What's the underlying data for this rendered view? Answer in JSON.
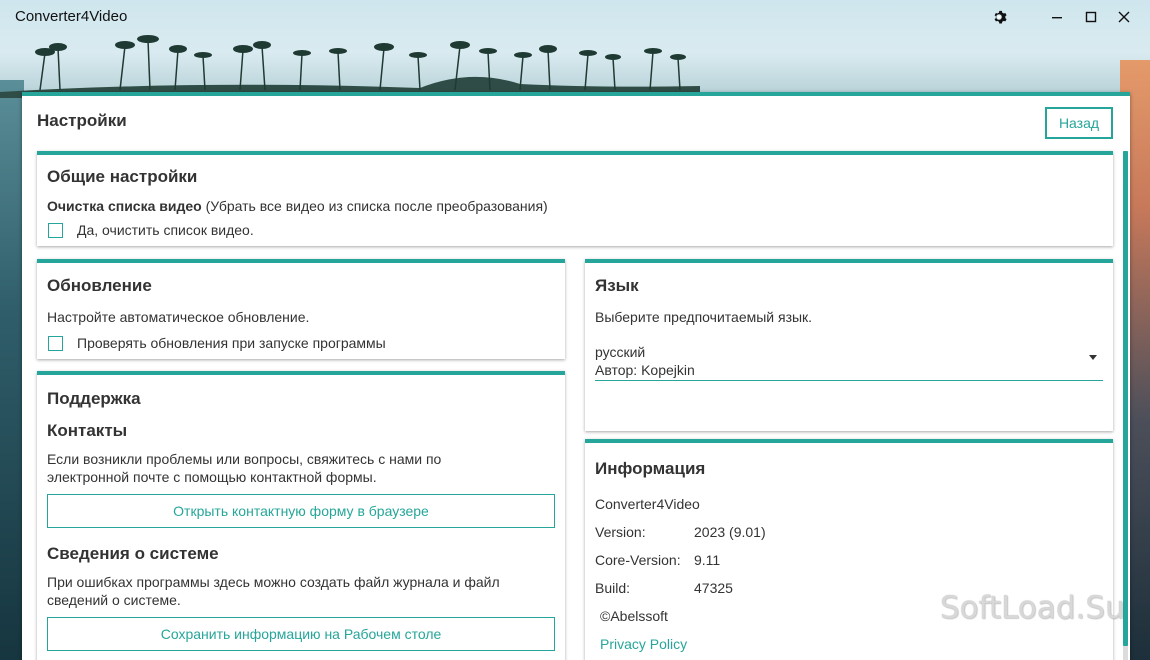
{
  "window": {
    "title": "Converter4Video",
    "settings_icon": "gear-icon",
    "minimize_icon": "minimize-icon",
    "maximize_icon": "maximize-icon",
    "close_icon": "close-icon"
  },
  "page": {
    "title": "Настройки",
    "back_label": "Назад"
  },
  "general": {
    "title": "Общие настройки",
    "clear_label_bold": "Очистка списка видео",
    "clear_label_rest": " (Убрать все видео из списка после преобразования)",
    "checkbox_label": "Да, очистить список видео.",
    "checked": false
  },
  "update": {
    "title": "Обновление",
    "description": "Настройте автоматическое обновление.",
    "checkbox_label": "Проверять обновления при запуске программы",
    "checked": false
  },
  "language": {
    "title": "Язык",
    "description": "Выберите предпочитаемый язык.",
    "selected": "русский",
    "author": "Автор: Kopejkin"
  },
  "support": {
    "title": "Поддержка",
    "contacts_title": "Контакты",
    "contacts_text_1": "Если возникли проблемы или вопросы, свяжитесь с нами по",
    "contacts_text_2": "электронной почте с помощью контактной формы.",
    "contact_button": "Открыть контактную форму в браузере",
    "sysinfo_title": "Сведения о системе",
    "sysinfo_text_1": "При ошибках программы здесь можно создать файл журнала и файл",
    "sysinfo_text_2": "сведений о системе.",
    "save_button": "Сохранить информацию на Рабочем столе"
  },
  "info": {
    "title": "Информация",
    "product": "Converter4Video",
    "rows": [
      {
        "label": "Version:",
        "value": "2023 (9.01)"
      },
      {
        "label": "Core-Version:",
        "value": "9.11"
      },
      {
        "label": "Build:",
        "value": "47325"
      }
    ],
    "copyright": "©Abelssoft",
    "privacy_link": "Privacy Policy"
  },
  "watermark": "SoftLoad.Su",
  "colors": {
    "accent": "#26a69a",
    "text": "#333333"
  }
}
